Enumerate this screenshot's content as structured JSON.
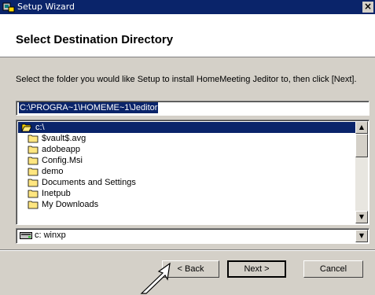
{
  "window": {
    "title": "Setup Wizard",
    "close_label": "×"
  },
  "header": {
    "heading": "Select Destination Directory"
  },
  "instruction": "Select the folder you would like Setup to install HomeMeeting Jeditor to, then click [Next].",
  "path_field": {
    "value": "C:\\PROGRA~1\\HOMEME~1\\Jeditor"
  },
  "folders": [
    {
      "label": "c:\\",
      "selected": true,
      "icon": "open-folder-icon"
    },
    {
      "label": "$vault$.avg",
      "icon": "folder-icon"
    },
    {
      "label": "adobeapp",
      "icon": "folder-icon"
    },
    {
      "label": "Config.Msi",
      "icon": "folder-icon"
    },
    {
      "label": "demo",
      "icon": "folder-icon"
    },
    {
      "label": "Documents and Settings",
      "icon": "folder-icon"
    },
    {
      "label": "Inetpub",
      "icon": "folder-icon"
    },
    {
      "label": "My Downloads",
      "icon": "folder-icon"
    }
  ],
  "drive": {
    "label": "c:  winxp",
    "icon": "drive-icon"
  },
  "buttons": {
    "back": "< Back",
    "next": "Next >",
    "cancel": "Cancel"
  },
  "colors": {
    "titlebar": "#0a246a",
    "selection": "#0a246a",
    "face": "#d4d0c8"
  }
}
